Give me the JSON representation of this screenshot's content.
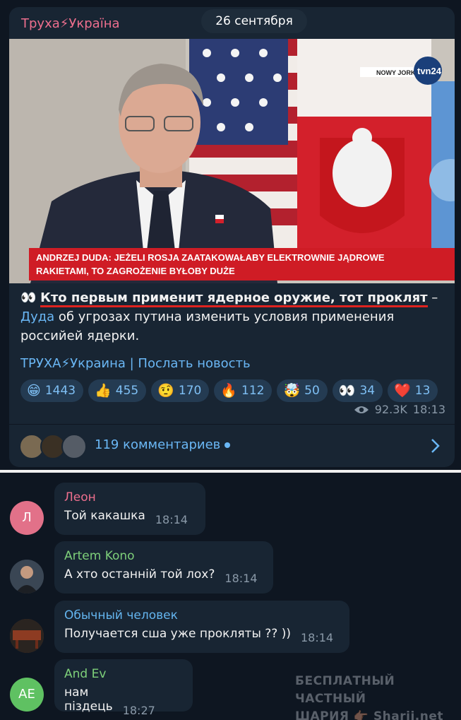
{
  "post": {
    "channel_name": "Труха⚡Україна",
    "date": "26 сентября",
    "photo": {
      "broadcaster_logo": "tvn24",
      "location_label": "NOWY JORK",
      "headline_line1": "ANDRZEJ DUDA: JEŻELI ROSJA ZAATAKOWAŁABY ELEKTROWNIE JĄDROWE",
      "headline_line2": "RAKIETAMI, TO ZAGROŻENIE BYŁOBY DUŻE"
    },
    "text": {
      "emoji": "👀",
      "lead": "Кто первым применит ядерное оружие, тот проклят",
      "dash": " – ",
      "mention": "Дуда",
      "rest": " об угрозах путина изменить условия применения российей ядерки."
    },
    "footer_link_1": "ТРУХА⚡Украина",
    "footer_sep": " | ",
    "footer_link_2": "Послать новость",
    "reactions": [
      {
        "emoji": "😁",
        "count": "1443"
      },
      {
        "emoji": "👍",
        "count": "455"
      },
      {
        "emoji": "🤨",
        "count": "170"
      },
      {
        "emoji": "🔥",
        "count": "112"
      },
      {
        "emoji": "🤯",
        "count": "50"
      },
      {
        "emoji": "👀",
        "count": "34"
      },
      {
        "emoji": "❤️",
        "count": "13"
      }
    ],
    "views": "92.3K",
    "time": "18:13",
    "comments_label": "119 комментариев"
  },
  "comments": [
    {
      "name": "Леон",
      "initial": "Л",
      "text": "Той какашка",
      "time": "18:14",
      "name_color": "#ee6f8e",
      "avatar_color": "#e27189"
    },
    {
      "name": "Artem Kono",
      "initial": "",
      "text": "А хто останній той лох?",
      "time": "18:14",
      "name_color": "#7ed07a",
      "avatar_color": "#2a3440"
    },
    {
      "name": "Обычный человек",
      "initial": "",
      "text": "Получается сша уже прокляты ?? ))",
      "time": "18:14",
      "name_color": "#64b5ef",
      "avatar_color": "#6b3a28"
    },
    {
      "name": "And Ev",
      "initial": "AE",
      "text": "нам піздець",
      "time": "18:27",
      "name_color": "#7ed07a",
      "avatar_color": "#5fc162"
    }
  ],
  "watermark_line1": "БЕСПЛАТНЫЙ ЧАСТНЫЙ",
  "watermark_line2": "ШАРИЯ 👉🏿 Sharij.net"
}
